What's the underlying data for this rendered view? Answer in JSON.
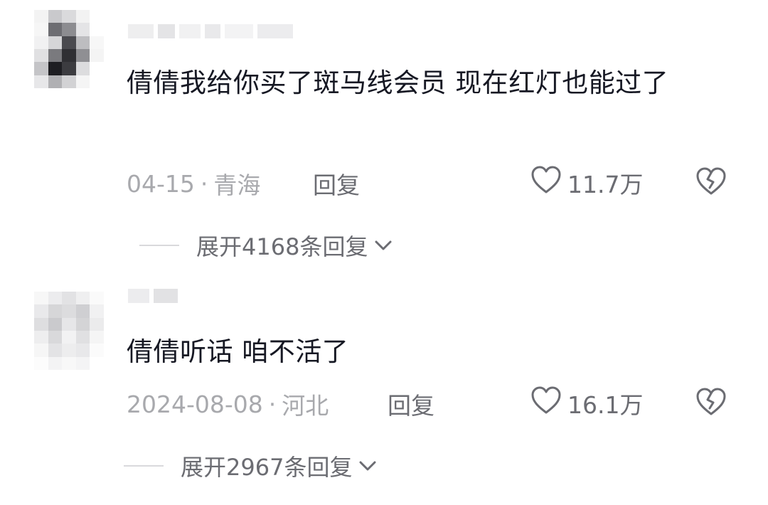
{
  "comments": [
    {
      "text": "倩倩我给你买了斑马线会员 现在红灯也能过了",
      "date": "04-15",
      "separator": "·",
      "location": "青海",
      "reply_label": "回复",
      "likes": "11.7万",
      "expand_label": "展开4168条回复"
    },
    {
      "text": "倩倩听话 咱不活了",
      "date": "2024-08-08",
      "separator": "·",
      "location": "河北",
      "reply_label": "回复",
      "likes": "16.1万",
      "expand_label": "展开2967条回复"
    }
  ],
  "icons": {
    "like": "heart-outline-icon",
    "dislike": "broken-heart-icon",
    "expand": "chevron-down-icon"
  },
  "colors": {
    "text_primary": "#161823",
    "text_meta": "#a8a9ad",
    "text_secondary": "#6b6c72"
  }
}
